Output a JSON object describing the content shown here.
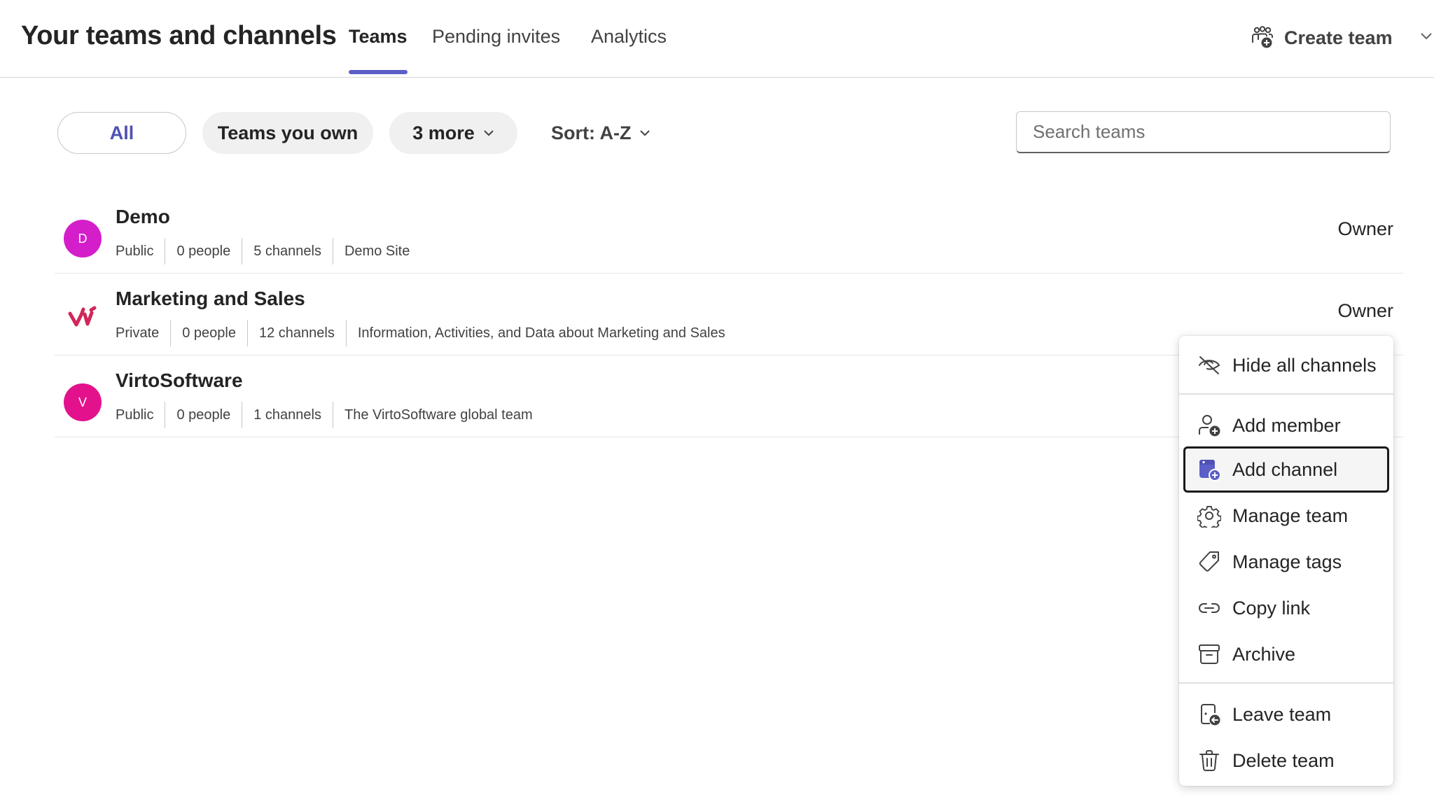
{
  "header": {
    "title": "Your teams and channels",
    "tabs": [
      {
        "label": "Teams",
        "active": true
      },
      {
        "label": "Pending invites",
        "active": false
      },
      {
        "label": "Analytics",
        "active": false
      }
    ],
    "create_team_label": "Create team"
  },
  "filters": {
    "all_label": "All",
    "own_label": "Teams you own",
    "more_label": "3 more",
    "sort_label": "Sort: A-Z",
    "search_placeholder": "Search teams"
  },
  "teams": [
    {
      "name": "Demo",
      "avatar_letter": "D",
      "avatar_color": "#d41ec9",
      "privacy": "Public",
      "people": "0 people",
      "channels": "5 channels",
      "description": "Demo Site",
      "role": "Owner"
    },
    {
      "name": "Marketing and Sales",
      "avatar_letter": "",
      "avatar_color": "#d1275a",
      "privacy": "Private",
      "people": "0 people",
      "channels": "12 channels",
      "description": "Information, Activities, and Data about Marketing and Sales",
      "role": "Owner"
    },
    {
      "name": "VirtoSoftware",
      "avatar_letter": "V",
      "avatar_color": "#e3128c",
      "privacy": "Public",
      "people": "0 people",
      "channels": "1 channels",
      "description": "The VirtoSoftware global team",
      "role": ""
    }
  ],
  "context_menu": {
    "items": [
      {
        "label": "Hide all channels",
        "icon": "eye-off-icon"
      },
      {
        "label": "Add member",
        "icon": "person-add-icon"
      },
      {
        "label": "Add channel",
        "icon": "channel-add-icon",
        "focused": true
      },
      {
        "label": "Manage team",
        "icon": "gear-icon"
      },
      {
        "label": "Manage tags",
        "icon": "tag-icon"
      },
      {
        "label": "Copy link",
        "icon": "link-icon"
      },
      {
        "label": "Archive",
        "icon": "archive-icon"
      },
      {
        "label": "Leave team",
        "icon": "leave-icon"
      },
      {
        "label": "Delete team",
        "icon": "trash-icon"
      }
    ]
  },
  "colors": {
    "accent": "#5b5fc7",
    "accent_text": "#4f52b2"
  }
}
